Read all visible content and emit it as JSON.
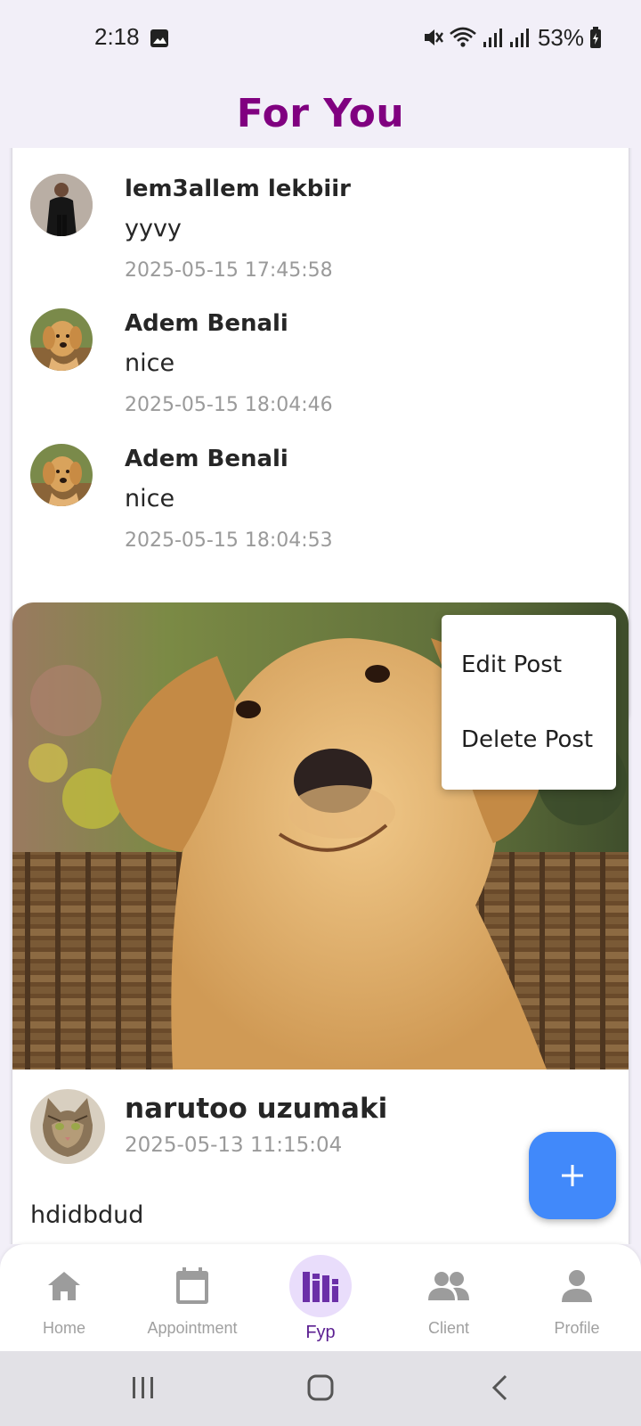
{
  "status_bar": {
    "time": "2:18",
    "battery": "53%"
  },
  "header": {
    "title": "For You"
  },
  "comments": [
    {
      "author": "lem3allem lekbiir",
      "text": "yyvy",
      "time": "2025-05-15 17:45:58",
      "avatar": "man-in-suit-avatar"
    },
    {
      "author": "Adem Benali",
      "text": "nice",
      "time": "2025-05-15 18:04:46",
      "avatar": "golden-retriever-avatar"
    },
    {
      "author": "Adem Benali",
      "text": "nice",
      "time": "2025-05-15 18:04:53",
      "avatar": "golden-retriever-avatar"
    }
  ],
  "post": {
    "image": "golden-retriever-puppy-photo",
    "author": "narutoo uzumaki",
    "time": "2025-05-13 11:15:04",
    "text": "hdidbdud"
  },
  "popup_menu": {
    "edit": "Edit Post",
    "delete": "Delete Post"
  },
  "bottom_nav": {
    "items": [
      {
        "label": "Home",
        "icon": "home-icon"
      },
      {
        "label": "Appointment",
        "icon": "calendar-icon"
      },
      {
        "label": "Fyp",
        "icon": "chart-bars-icon",
        "active": true
      },
      {
        "label": "Client",
        "icon": "people-icon"
      },
      {
        "label": "Profile",
        "icon": "person-icon"
      }
    ]
  },
  "colors": {
    "title": "#800080",
    "fab": "#4189fa",
    "active_nav": "#5b1f91",
    "active_nav_bg": "#e9ddfb"
  }
}
